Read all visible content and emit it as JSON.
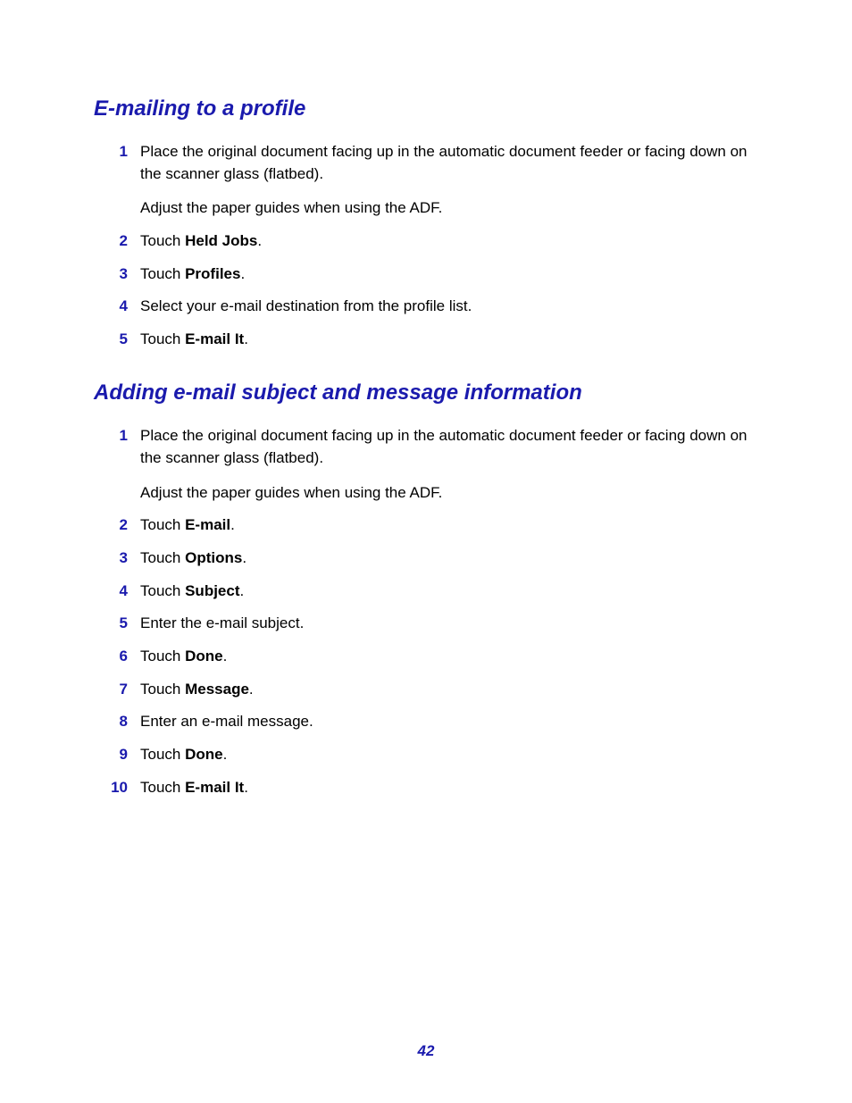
{
  "section1": {
    "heading": "E-mailing to a profile",
    "steps": [
      {
        "n": "1",
        "pre": "Place the original document facing up in the automatic document feeder or facing down on the scanner glass (flatbed).",
        "extra": "Adjust the paper guides when using the ADF."
      },
      {
        "n": "2",
        "pre": "Touch ",
        "bold": "Held Jobs",
        "post": "."
      },
      {
        "n": "3",
        "pre": "Touch ",
        "bold": "Profiles",
        "post": "."
      },
      {
        "n": "4",
        "pre": "Select your e-mail destination from the profile list."
      },
      {
        "n": "5",
        "pre": "Touch ",
        "bold": "E-mail It",
        "post": "."
      }
    ]
  },
  "section2": {
    "heading": "Adding e-mail subject and message information",
    "steps": [
      {
        "n": "1",
        "pre": "Place the original document facing up in the automatic document feeder or facing down on the scanner glass (flatbed).",
        "extra": "Adjust the paper guides when using the ADF."
      },
      {
        "n": "2",
        "pre": "Touch ",
        "bold": "E-mail",
        "post": "."
      },
      {
        "n": "3",
        "pre": "Touch ",
        "bold": "Options",
        "post": "."
      },
      {
        "n": "4",
        "pre": "Touch ",
        "bold": "Subject",
        "post": "."
      },
      {
        "n": "5",
        "pre": "Enter the e-mail subject."
      },
      {
        "n": "6",
        "pre": "Touch ",
        "bold": "Done",
        "post": "."
      },
      {
        "n": "7",
        "pre": "Touch ",
        "bold": "Message",
        "post": "."
      },
      {
        "n": "8",
        "pre": "Enter an e-mail message."
      },
      {
        "n": "9",
        "pre": "Touch ",
        "bold": "Done",
        "post": "."
      },
      {
        "n": "10",
        "pre": "Touch ",
        "bold": "E-mail It",
        "post": "."
      }
    ]
  },
  "pageNumber": "42"
}
